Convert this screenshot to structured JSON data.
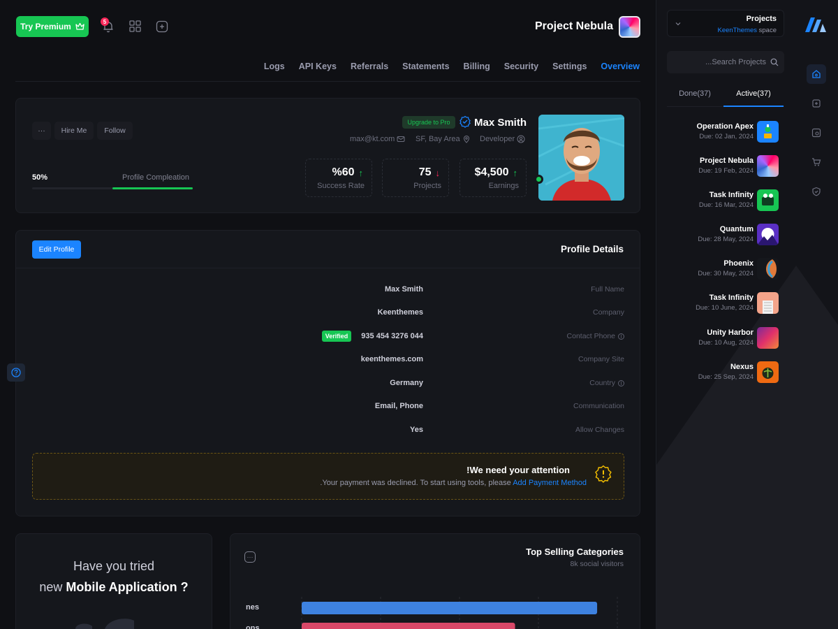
{
  "topbar": {
    "premium_label": "Try Premium",
    "notification_count": "5",
    "project_title": "Project Nebula"
  },
  "tabs": [
    "Logs",
    "API Keys",
    "Referrals",
    "Statements",
    "Billing",
    "Security",
    "Settings",
    "Overview"
  ],
  "profile": {
    "more_label": "···",
    "hire_label": "Hire Me",
    "follow_label": "Follow",
    "upgrade_label": "Upgrade to Pro",
    "name": "Max Smith",
    "email": "max@kt.com",
    "location": "SF, Bay Area",
    "role": "Developer",
    "completion_value": "50%",
    "completion_label": "Profile Compleation",
    "completion_fraction": 0.5,
    "stats": [
      {
        "value": "%60",
        "label": "Success Rate",
        "trend": "up"
      },
      {
        "value": "75",
        "label": "Projects",
        "trend": "down"
      },
      {
        "value": "$4,500",
        "label": "Earnings",
        "trend": "up"
      }
    ]
  },
  "details": {
    "edit_label": "Edit Profile",
    "title": "Profile Details",
    "verified_label": "Verified",
    "rows": [
      {
        "label": "Full Name",
        "value": "Max Smith"
      },
      {
        "label": "Company",
        "value": "Keenthemes"
      },
      {
        "label": "Contact Phone",
        "value": "935 454 3276 044"
      },
      {
        "label": "Company Site",
        "value": "keenthemes.com"
      },
      {
        "label": "Country",
        "value": "Germany"
      },
      {
        "label": "Communication",
        "value": "Email, Phone"
      },
      {
        "label": "Allow Changes",
        "value": "Yes"
      }
    ],
    "alert_title": "!We need your attention",
    "alert_text": ".Your payment was declined. To start using tools, please ",
    "alert_link": "Add Payment Method"
  },
  "mobile": {
    "line1": "Have you tried",
    "line2_prefix": "new ",
    "line2_bold": "Mobile Application ?"
  },
  "chart_data": {
    "type": "bar",
    "title": "Top Selling Categories",
    "subtitle": "8k social visitors",
    "categories": [
      "nes",
      "ons"
    ],
    "values": [
      0.9,
      0.65
    ],
    "colors": [
      "#3e82e0",
      "#d94868"
    ]
  },
  "right_panel": {
    "select_title": "Projects",
    "select_sub_link": "KeenThemes",
    "select_sub_rest": " space",
    "search_placeholder": "...Search Projects",
    "tab_done": "Done(37)",
    "tab_active": "Active(37)",
    "projects": [
      {
        "name": "Operation Apex",
        "due": "Due: 02 Jan, 2024",
        "color": "#1b84ff"
      },
      {
        "name": "Project Nebula",
        "due": "Due: 19 Feb, 2024",
        "color": "#c9a8e8"
      },
      {
        "name": "Task Infinity",
        "due": "Due: 16 Mar, 2024",
        "color": "#17c653"
      },
      {
        "name": "Quantum",
        "due": "Due: 28 May, 2024",
        "color": "#6a3fd1"
      },
      {
        "name": "Phoenix",
        "due": "Due: 30 May, 2024",
        "color": "#2a2c34"
      },
      {
        "name": "Task Infinity",
        "due": "Due: 10 June, 2024",
        "color": "#f4a48a"
      },
      {
        "name": "Unity Harbor",
        "due": "Due: 10 Aug, 2024",
        "color": "#c4275d"
      },
      {
        "name": "Nexus",
        "due": "Due: 25 Sep, 2024",
        "color": "#ef6a12"
      }
    ]
  }
}
